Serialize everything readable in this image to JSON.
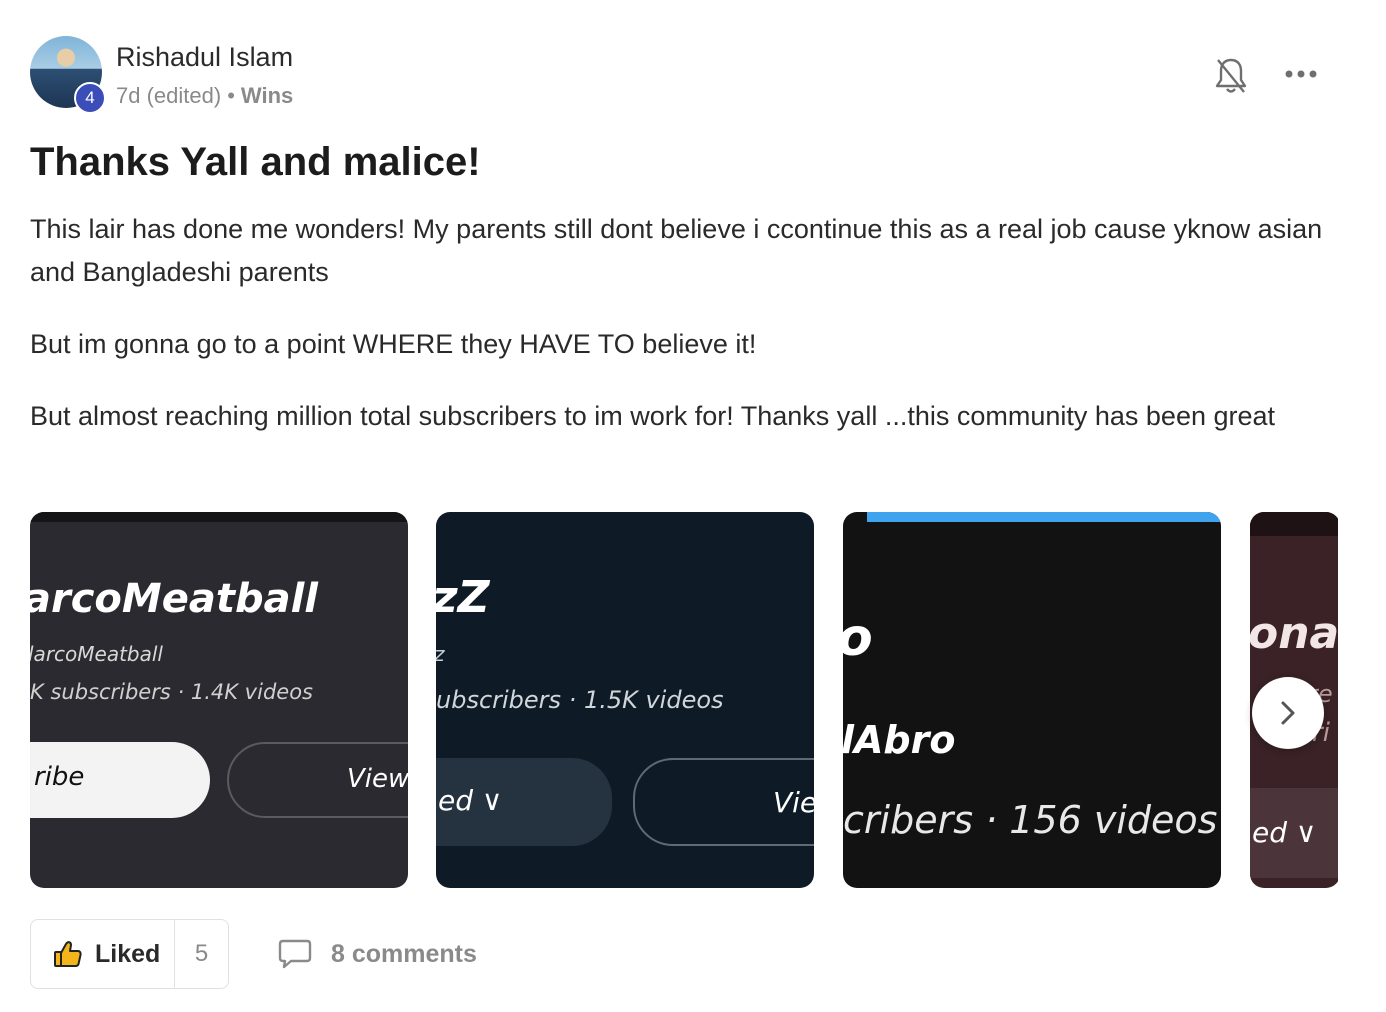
{
  "post": {
    "author": "Rishadul Islam",
    "level": "4",
    "time": "7d (edited)",
    "separator": "•",
    "category": "Wins",
    "title": "Thanks Yall and malice!",
    "paragraphs": [
      "This lair has done me wonders! My parents still dont believe i ccontinue this as a real job cause yknow asian and Bangladeshi parents",
      "But im gonna go to a point WHERE they HAVE TO believe it!",
      "But almost reaching million total subscribers to im work for! Thanks yall ...this community has been great"
    ]
  },
  "icons": {
    "bell": "bell-off-icon",
    "more": "more-options-icon",
    "like": "thumbs-up-icon",
    "comment": "comment-icon",
    "next": "chevron-right-icon"
  },
  "gallery": [
    {
      "name": "arcoMeatball",
      "handle": "larcoMeatball",
      "stats": "K subscribers · 1.4K videos",
      "primary": "ribe",
      "secondary": "View"
    },
    {
      "name": "zZ",
      "handle": "z",
      "stats": "ubscribers · 1.5K videos",
      "primary": "ed ∨",
      "secondary": "Vie"
    },
    {
      "name": "o",
      "handle": "lAbro",
      "stats": "cribers · 156 videos"
    },
    {
      "name": "onaS",
      "handle": "re",
      "stats": "ri",
      "primary": "ed ∨"
    }
  ],
  "actions": {
    "like_label": "Liked",
    "like_count": "5",
    "comments_label": "8 comments"
  },
  "colors": {
    "badge": "#3b4db8",
    "accent_bar": "#3fa3ee"
  }
}
